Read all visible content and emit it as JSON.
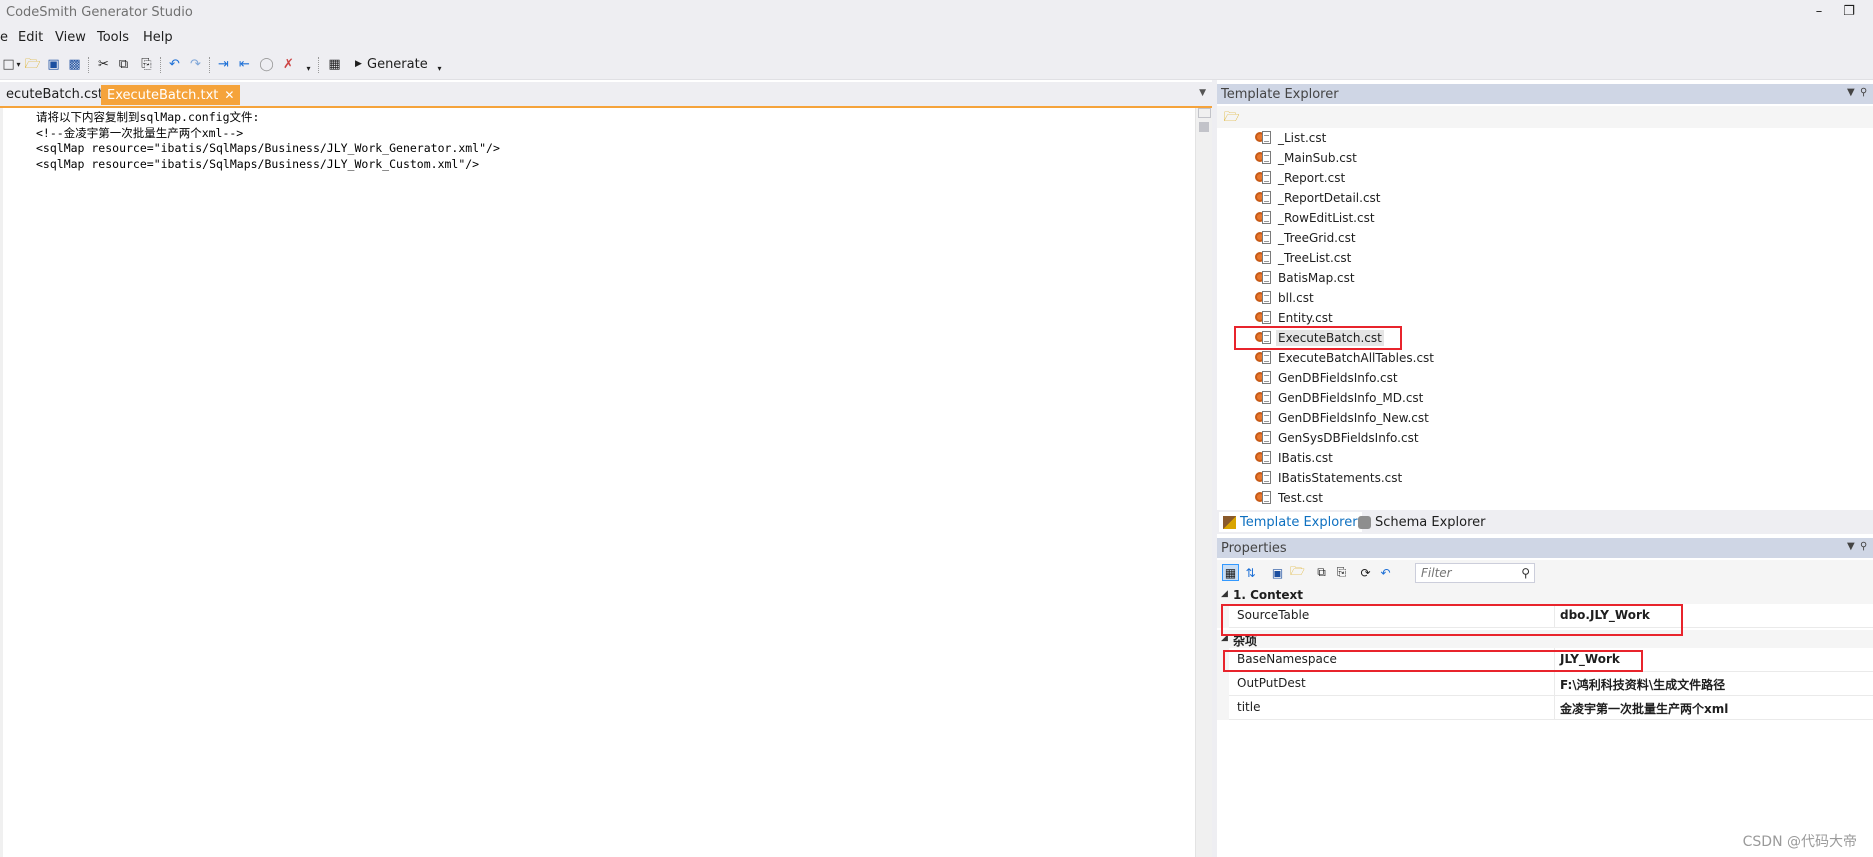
{
  "app": {
    "title": "CodeSmith Generator Studio"
  },
  "menu": {
    "file": "e",
    "edit": "Edit",
    "view": "View",
    "tools": "Tools",
    "help": "Help"
  },
  "toolbar": {
    "generate_label": "Generate"
  },
  "editor": {
    "tabs": [
      {
        "label": "ecuteBatch.cst",
        "active": false
      },
      {
        "label": "ExecuteBatch.txt",
        "active": true,
        "close": "✕"
      }
    ],
    "lines": [
      "请将以下内容复制到sqlMap.config文件:",
      "<!--金凌宇第一次批量生产两个xml-->",
      "<sqlMap resource=\"ibatis/SqlMaps/Business/JLY_Work_Generator.xml\"/>",
      "<sqlMap resource=\"ibatis/SqlMaps/Business/JLY_Work_Custom.xml\"/>"
    ]
  },
  "template_explorer": {
    "title": "Template Explorer",
    "files": [
      "_List.cst",
      "_MainSub.cst",
      "_Report.cst",
      "_ReportDetail.cst",
      "_RowEditList.cst",
      "_TreeGrid.cst",
      "_TreeList.cst",
      "BatisMap.cst",
      "bll.cst",
      "Entity.cst",
      "ExecuteBatch.cst",
      "ExecuteBatchAllTables.cst",
      "GenDBFieldsInfo.cst",
      "GenDBFieldsInfo_MD.cst",
      "GenDBFieldsInfo_New.cst",
      "GenSysDBFieldsInfo.cst",
      "IBatis.cst",
      "IBatisStatements.cst",
      "Test.cst"
    ],
    "selected": "ExecuteBatch.cst",
    "tabs": {
      "template": "Template Explorer",
      "schema": "Schema Explorer"
    }
  },
  "properties": {
    "title": "Properties",
    "filter_placeholder": "Filter",
    "categories": [
      {
        "name": "1. Context",
        "rows": [
          {
            "name": "SourceTable",
            "value": "dbo.JLY_Work"
          }
        ]
      },
      {
        "name": "杂项",
        "rows": [
          {
            "name": "BaseNamespace",
            "value": "JLY_Work"
          },
          {
            "name": "OutPutDest",
            "value": "F:\\鸿利科技资料\\生成文件路径"
          },
          {
            "name": "title",
            "value": "金凌宇第一次批量生产两个xml"
          }
        ]
      }
    ]
  },
  "watermark": "CSDN @代码大帝",
  "colors": {
    "accent_tab": "#f5a33b",
    "highlight": "#e8242c",
    "panel_header": "#cfd6e5",
    "link_blue": "#0e70c0"
  }
}
